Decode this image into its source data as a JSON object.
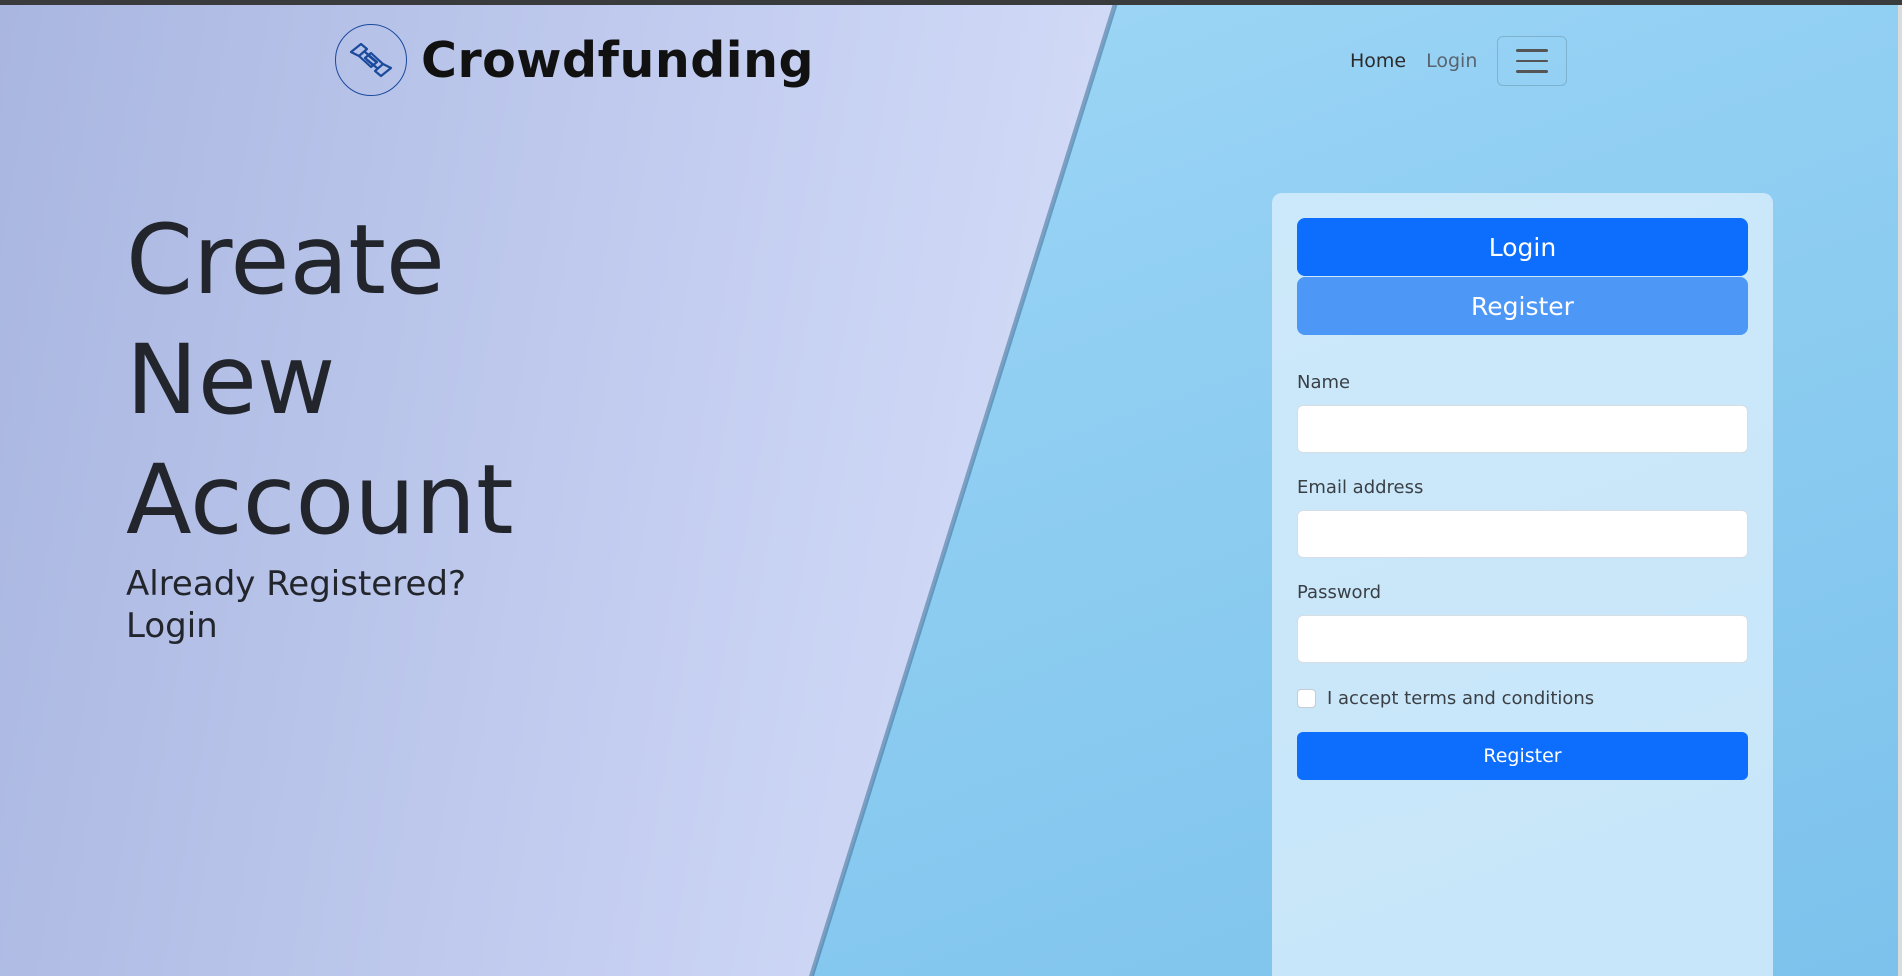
{
  "brand": {
    "name": "Crowdfunding",
    "logo_icon": "handshake-icon"
  },
  "nav": {
    "home": "Home",
    "login": "Login",
    "menu_icon": "hamburger-menu-icon"
  },
  "hero": {
    "title_line1": "Create",
    "title_line2": "New",
    "title_line3": "Account",
    "already_registered": "Already Registered?",
    "login_link": "Login"
  },
  "form": {
    "tab_login": "Login",
    "tab_register": "Register",
    "name_label": "Name",
    "name_value": "",
    "email_label": "Email address",
    "email_value": "",
    "password_label": "Password",
    "password_value": "",
    "terms_label": "I accept terms and conditions",
    "terms_checked": false,
    "submit_label": "Register"
  },
  "colors": {
    "primary": "#0d6efd",
    "primary_light": "#4d97f7",
    "text_dark": "#22262c"
  }
}
